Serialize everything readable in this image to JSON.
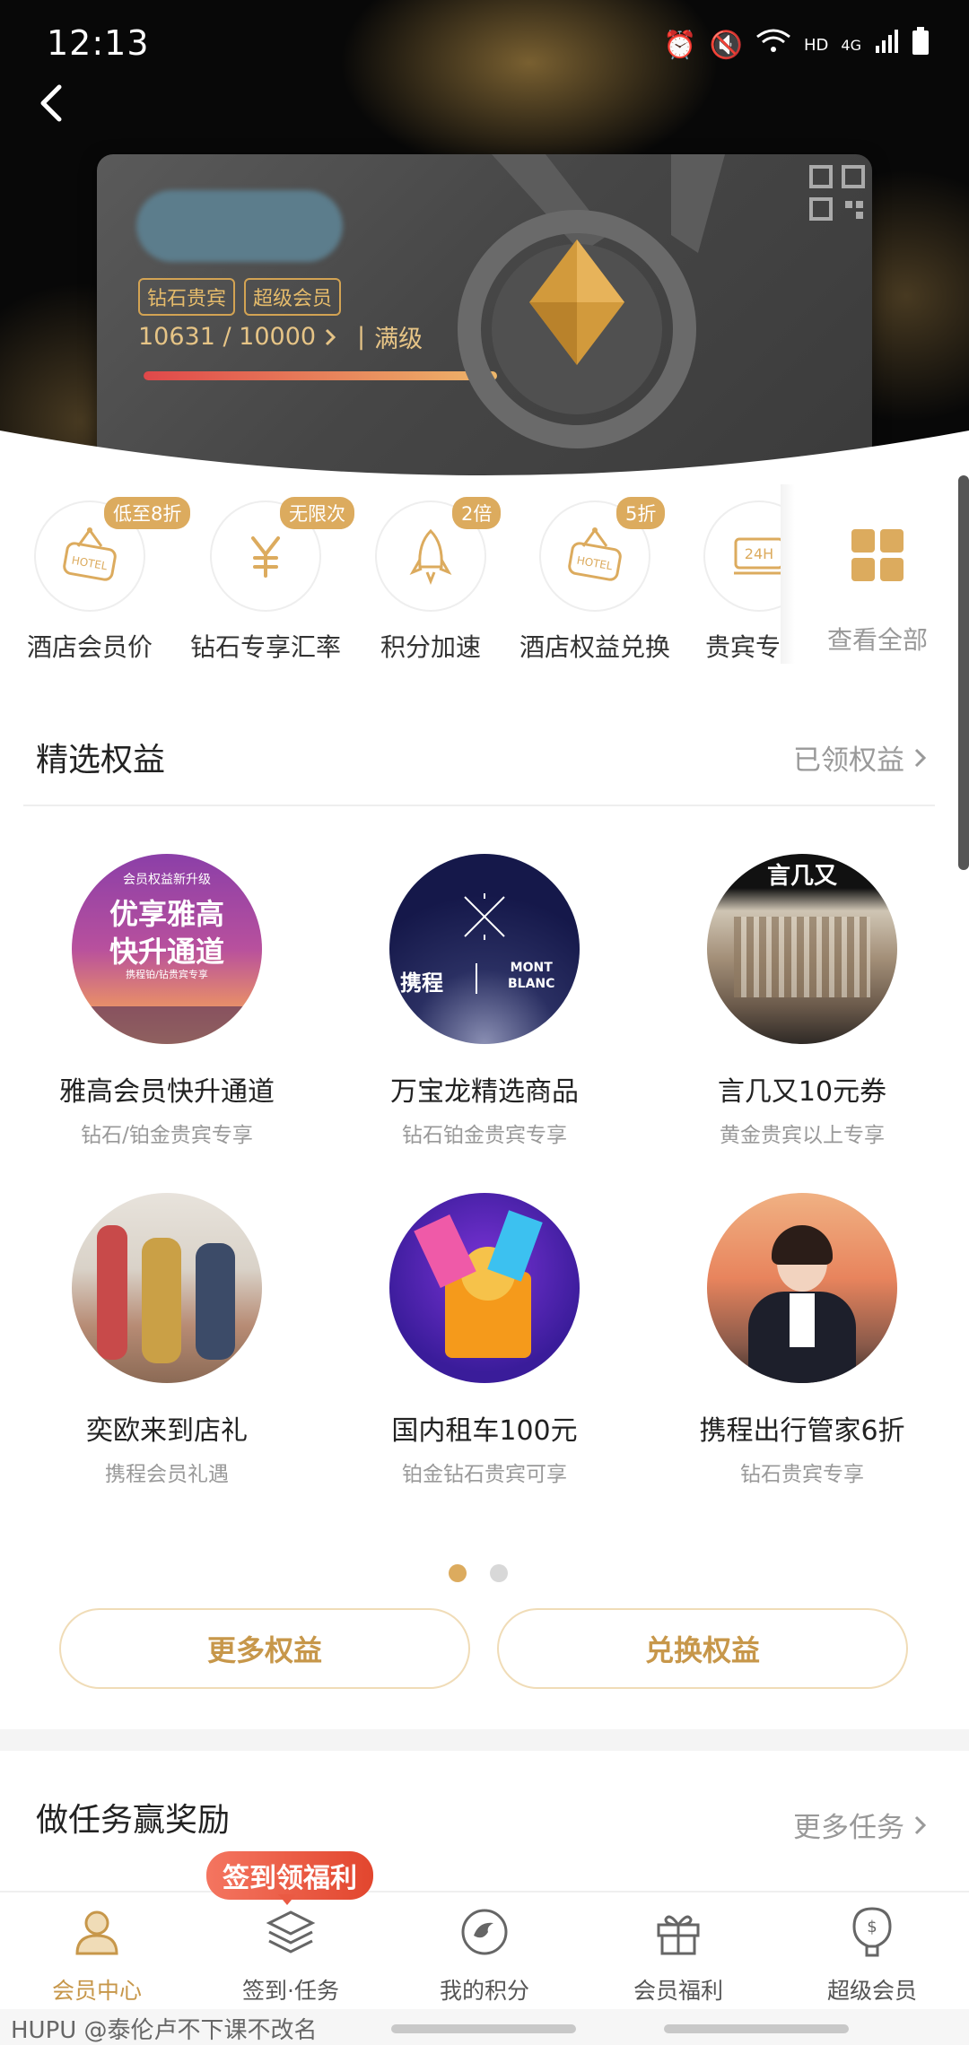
{
  "status_bar": {
    "time": "12:13",
    "network": "HD",
    "signal": "4G"
  },
  "card": {
    "badges": [
      "钻石贵宾",
      "超级会员"
    ],
    "points": "10631 / 10000",
    "level_status": "满级",
    "progress_fraction": 1.0
  },
  "benefits": [
    {
      "tag": "低至8折",
      "label": "酒店会员价",
      "icon": "hotel-sign-icon"
    },
    {
      "tag": "无限次",
      "label": "钻石专享汇率",
      "icon": "yuan-icon"
    },
    {
      "tag": "2倍",
      "label": "积分加速",
      "icon": "rocket-icon"
    },
    {
      "tag": "5折",
      "label": "酒店权益兑换",
      "icon": "hotel-sign-icon"
    },
    {
      "tag": "",
      "label": "贵宾专",
      "icon": "24h-icon"
    }
  ],
  "view_all": {
    "label": "查看全部"
  },
  "featured": {
    "title": "精选权益",
    "more": "已领权益",
    "items": [
      {
        "title": "雅高会员快升通道",
        "sub": "钻石/铂金贵宾专享",
        "img_text": [
          "会员权益新升级",
          "优享雅高",
          "快升通道",
          "携程铂/钻贵宾专享"
        ]
      },
      {
        "title": "万宝龙精选商品",
        "sub": "钻石铂金贵宾专享",
        "img_text": [
          "携程",
          "MONT",
          "BLANC"
        ]
      },
      {
        "title": "言几又10元券",
        "sub": "黄金贵宾以上专享",
        "img_text": [
          "言几又"
        ]
      },
      {
        "title": "奕欧来到店礼",
        "sub": "携程会员礼遇",
        "img_text": []
      },
      {
        "title": "国内租车100元",
        "sub": "铂金钻石贵宾可享",
        "img_text": []
      },
      {
        "title": "携程出行管家6折",
        "sub": "钻石贵宾专享",
        "img_text": []
      }
    ],
    "page_count": 2,
    "active_page": 1
  },
  "actions": {
    "more": "更多权益",
    "exchange": "兑换权益"
  },
  "tasks": {
    "title": "做任务赢奖励",
    "more": "更多任务"
  },
  "signin_badge": "签到领福利",
  "bottom_nav": [
    {
      "label": "会员中心",
      "icon": "user-icon",
      "active": true
    },
    {
      "label": "签到·任务",
      "icon": "layers-icon",
      "active": false
    },
    {
      "label": "我的积分",
      "icon": "points-icon",
      "active": false
    },
    {
      "label": "会员福利",
      "icon": "gift-icon",
      "active": false
    },
    {
      "label": "超级会员",
      "icon": "balloon-icon",
      "active": false
    }
  ],
  "watermark": "HUPU @泰伦卢不下课不改名",
  "colors": {
    "gold": "#dcab5e",
    "gold_text": "#c7974a",
    "card_dark": "#454545",
    "active_dot": "#dcab5e"
  }
}
